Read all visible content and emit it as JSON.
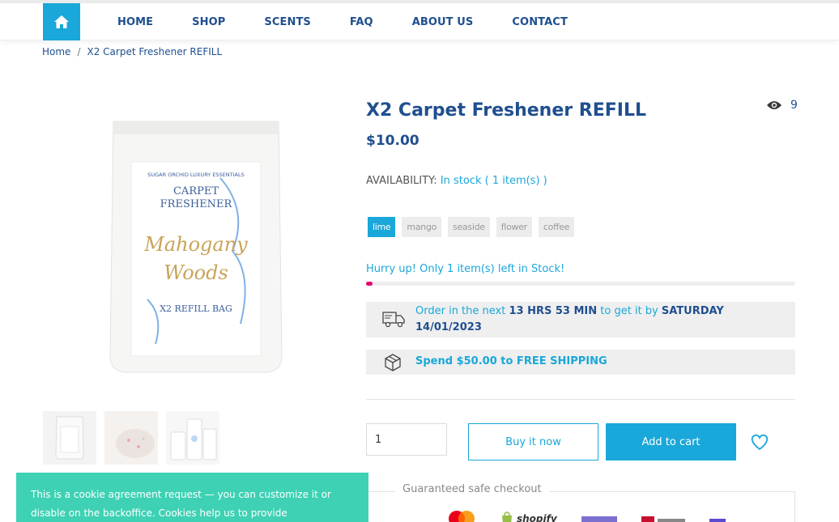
{
  "nav": {
    "items": [
      "HOME",
      "SHOP",
      "SCENTS",
      "FAQ",
      "ABOUT US",
      "CONTACT"
    ]
  },
  "breadcrumb": {
    "home": "Home",
    "separator": "/",
    "current": "X2 Carpet Freshener REFILL"
  },
  "product": {
    "title": "X2 Carpet Freshener REFILL",
    "views": "9",
    "price": "$10.00",
    "availability_label": "AVAILABILITY:",
    "availability_value": "In stock ( 1 item(s) )",
    "scents": [
      "lime",
      "mango",
      "seaside",
      "flower",
      "coffee"
    ],
    "selected_scent": "lime",
    "hurry_text": "Hurry up! Only 1 item(s) left in Stock!",
    "stock_progress": 0.015,
    "package_labels": {
      "brand": "SUGAR ORCHID LUXURY ESSENTIALS",
      "name_line1": "CARPET",
      "name_line2": "FRESHENER",
      "scent_line1": "Mahogany",
      "scent_line2": "Woods",
      "bag": "X2 REFILL BAG"
    }
  },
  "delivery": {
    "prefix": "Order in the next ",
    "time": "13 HRS 53 MIN",
    "middle": " to get it by ",
    "date": "SATURDAY 14/01/2023"
  },
  "shipping": {
    "text": "Spend $50.00 to FREE SHIPPING"
  },
  "actions": {
    "quantity": "1",
    "buy_now": "Buy it now",
    "add_to_cart": "Add to cart"
  },
  "checkout": {
    "title": "Guaranteed safe checkout",
    "shopify": "shopify"
  },
  "cookie": {
    "text": "This is a cookie agreement request — you can customize it or disable on the backoffice. Cookies help us to provide"
  },
  "colors": {
    "primary": "#1aa7d9",
    "navy": "#1f4f8f",
    "stock_bar": "#e6006d",
    "cookie_bg": "#3ed1b4"
  }
}
